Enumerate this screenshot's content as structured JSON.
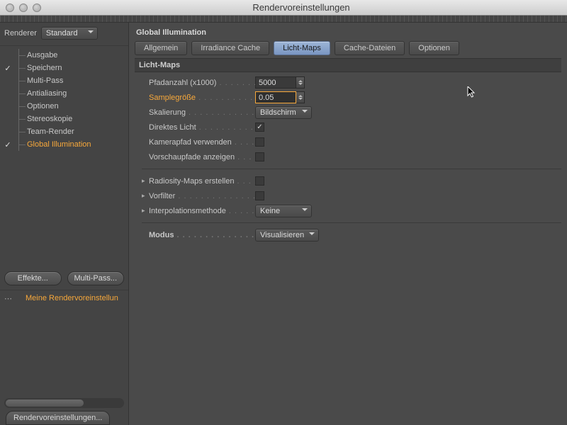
{
  "window": {
    "title": "Rendervoreinstellungen"
  },
  "renderer": {
    "label": "Renderer",
    "value": "Standard"
  },
  "tree": {
    "items": [
      {
        "label": "Ausgabe",
        "checked": ""
      },
      {
        "label": "Speichern",
        "checked": "✓"
      },
      {
        "label": "Multi-Pass",
        "checked": ""
      },
      {
        "label": "Antialiasing",
        "checked": ""
      },
      {
        "label": "Optionen",
        "checked": ""
      },
      {
        "label": "Stereoskopie",
        "checked": ""
      },
      {
        "label": "Team-Render",
        "checked": ""
      },
      {
        "label": "Global Illumination",
        "checked": "✓",
        "highlight": true
      }
    ]
  },
  "buttons": {
    "effects": "Effekte...",
    "multipass": "Multi-Pass..."
  },
  "preset": {
    "label": "Meine Rendervoreinstellun"
  },
  "footer": {
    "button": "Rendervoreinstellungen..."
  },
  "panel": {
    "title": "Global Illumination",
    "tabs": [
      "Allgemein",
      "Irradiance Cache",
      "Licht-Maps",
      "Cache-Dateien",
      "Optionen"
    ],
    "active_tab": 2,
    "subhead": "Licht-Maps",
    "params": {
      "pfadanzahl": {
        "label": "Pfadanzahl (x1000)",
        "value": "5000"
      },
      "samplegroesse": {
        "label": "Samplegröße",
        "value": "0.05"
      },
      "skalierung": {
        "label": "Skalierung",
        "value": "Bildschirm"
      },
      "direktes_licht": {
        "label": "Direktes Licht",
        "checked": "✓"
      },
      "kamerapfad": {
        "label": "Kamerapfad verwenden",
        "checked": ""
      },
      "vorschaupfade": {
        "label": "Vorschaupfade anzeigen",
        "checked": ""
      },
      "radiosity": {
        "label": "Radiosity-Maps erstellen",
        "checked": ""
      },
      "vorfilter": {
        "label": "Vorfilter",
        "checked": ""
      },
      "interpolation": {
        "label": "Interpolationsmethode",
        "value": "Keine"
      },
      "modus": {
        "label": "Modus",
        "value": "Visualisieren"
      }
    }
  }
}
